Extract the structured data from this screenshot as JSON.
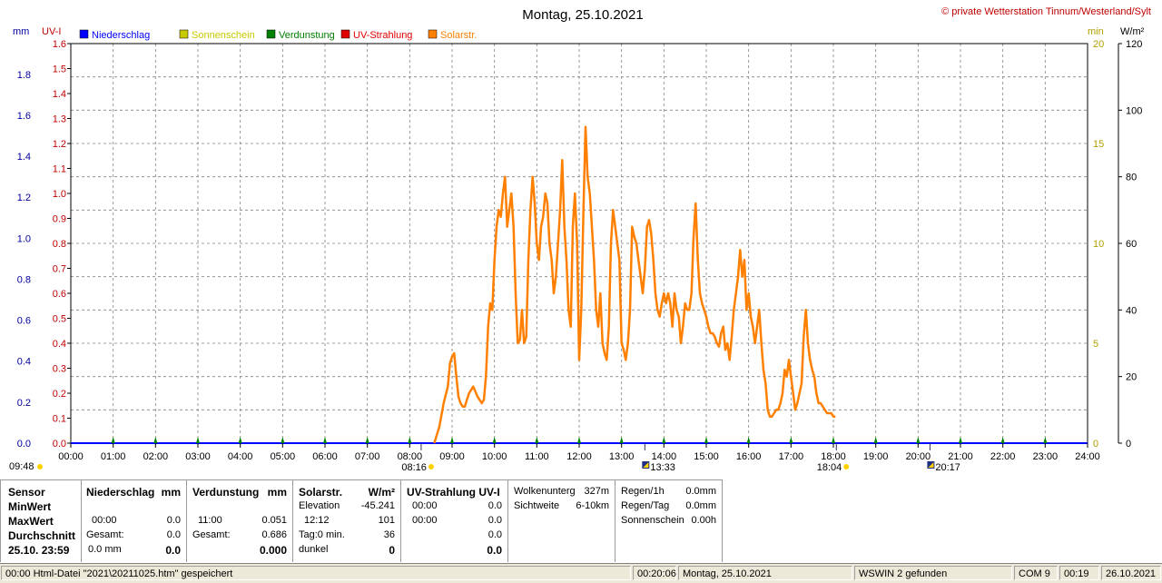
{
  "chart_data": {
    "type": "line",
    "title": "Montag, 25.10.2021",
    "copyright": "© private Wetterstation Tinnum/Westerland/Sylt",
    "legend": [
      {
        "name": "Niederschlag",
        "color": "#0000ff"
      },
      {
        "name": "Sonnenschein",
        "color": "#c8c800"
      },
      {
        "name": "Verdunstung",
        "color": "#008000"
      },
      {
        "name": "UV-Strahlung",
        "color": "#e00000"
      },
      {
        "name": "Solarstr.",
        "color": "#ff8000"
      }
    ],
    "axes": {
      "mm": {
        "label": "mm",
        "color": "#0000a0",
        "ticks": [
          "0.0",
          "0.2",
          "0.4",
          "0.6",
          "0.8",
          "1.0",
          "1.2",
          "1.4",
          "1.6",
          "1.8"
        ],
        "range": [
          0,
          1.95
        ]
      },
      "uv": {
        "label": "UV-I",
        "color": "#c00000",
        "ticks": [
          "0.0",
          "0.1",
          "0.2",
          "0.3",
          "0.4",
          "0.5",
          "0.6",
          "0.7",
          "0.8",
          "0.9",
          "1.0",
          "1.1",
          "1.2",
          "1.3",
          "1.4",
          "1.5",
          "1.6"
        ],
        "range": [
          0,
          1.6
        ]
      },
      "min": {
        "label": "min",
        "color": "#b0a000",
        "ticks": [
          "0",
          "5",
          "10",
          "15",
          "20"
        ],
        "range": [
          0,
          20
        ]
      },
      "wm2": {
        "label": "W/m²",
        "color": "#000000",
        "ticks": [
          "0",
          "20",
          "40",
          "60",
          "80",
          "100",
          "120"
        ],
        "range": [
          0,
          120
        ]
      },
      "x": {
        "ticks": [
          "00:00",
          "01:00",
          "02:00",
          "03:00",
          "04:00",
          "05:00",
          "06:00",
          "07:00",
          "08:00",
          "09:00",
          "10:00",
          "11:00",
          "12:00",
          "13:00",
          "14:00",
          "15:00",
          "16:00",
          "17:00",
          "18:00",
          "19:00",
          "20:00",
          "21:00",
          "22:00",
          "23:00",
          "24:00"
        ],
        "range": [
          0,
          24
        ]
      }
    },
    "grid": true,
    "solar": {
      "name": "Solarstr.",
      "color": "#ff8000",
      "axis": "wm2",
      "x": [
        8.58,
        8.7,
        8.8,
        8.9,
        8.95,
        9.0,
        9.05,
        9.1,
        9.15,
        9.2,
        9.25,
        9.3,
        9.35,
        9.4,
        9.5,
        9.6,
        9.7,
        9.75,
        9.8,
        9.85,
        9.9,
        9.95,
        10.0,
        10.05,
        10.1,
        10.15,
        10.2,
        10.25,
        10.3,
        10.35,
        10.4,
        10.45,
        10.5,
        10.55,
        10.6,
        10.65,
        10.7,
        10.75,
        10.8,
        10.85,
        10.9,
        10.95,
        11.0,
        11.05,
        11.1,
        11.15,
        11.2,
        11.25,
        11.3,
        11.35,
        11.4,
        11.45,
        11.5,
        11.55,
        11.6,
        11.65,
        11.7,
        11.75,
        11.8,
        11.85,
        11.9,
        11.95,
        12.0,
        12.05,
        12.1,
        12.15,
        12.2,
        12.25,
        12.3,
        12.35,
        12.4,
        12.45,
        12.5,
        12.55,
        12.6,
        12.65,
        12.7,
        12.75,
        12.8,
        12.85,
        12.9,
        12.95,
        13.0,
        13.05,
        13.1,
        13.15,
        13.2,
        13.25,
        13.3,
        13.35,
        13.4,
        13.45,
        13.5,
        13.55,
        13.6,
        13.65,
        13.7,
        13.75,
        13.8,
        13.85,
        13.9,
        13.95,
        14.0,
        14.05,
        14.1,
        14.15,
        14.2,
        14.25,
        14.3,
        14.35,
        14.4,
        14.45,
        14.5,
        14.55,
        14.6,
        14.65,
        14.7,
        14.75,
        14.8,
        14.85,
        14.9,
        14.95,
        15.0,
        15.05,
        15.1,
        15.15,
        15.2,
        15.25,
        15.3,
        15.35,
        15.4,
        15.45,
        15.5,
        15.55,
        15.6,
        15.65,
        15.7,
        15.75,
        15.8,
        15.85,
        15.9,
        15.95,
        16.0,
        16.05,
        16.1,
        16.15,
        16.2,
        16.25,
        16.3,
        16.35,
        16.4,
        16.45,
        16.5,
        16.55,
        16.6,
        16.65,
        16.7,
        16.75,
        16.8,
        16.85,
        16.9,
        16.95,
        17.0,
        17.05,
        17.1,
        17.15,
        17.2,
        17.25,
        17.3,
        17.35,
        17.4,
        17.45,
        17.5,
        17.55,
        17.6,
        17.65,
        17.7,
        17.75,
        17.8,
        17.85,
        17.9,
        17.95,
        18.0,
        18.05
      ],
      "values": [
        0,
        5,
        12,
        17,
        24,
        26,
        27,
        20,
        14,
        12,
        11,
        11,
        13,
        15,
        17,
        14,
        12,
        13,
        20,
        35,
        42,
        40,
        55,
        65,
        70,
        68,
        75,
        80,
        65,
        70,
        75,
        65,
        45,
        30,
        31,
        40,
        30,
        32,
        55,
        70,
        80,
        72,
        60,
        55,
        65,
        68,
        75,
        72,
        60,
        55,
        45,
        50,
        60,
        70,
        85,
        65,
        55,
        40,
        35,
        65,
        75,
        60,
        25,
        40,
        70,
        95,
        80,
        75,
        65,
        55,
        40,
        35,
        45,
        30,
        27,
        25,
        35,
        60,
        70,
        65,
        60,
        55,
        30,
        28,
        25,
        30,
        40,
        65,
        62,
        60,
        55,
        50,
        45,
        52,
        65,
        67,
        63,
        55,
        45,
        40,
        38,
        42,
        45,
        42,
        45,
        42,
        35,
        45,
        40,
        38,
        30,
        35,
        42,
        40,
        40,
        45,
        62,
        72,
        55,
        45,
        42,
        40,
        38,
        35,
        33,
        33,
        32,
        30,
        29,
        33,
        35,
        28,
        30,
        25,
        32,
        40,
        45,
        50,
        58,
        50,
        55,
        40,
        45,
        38,
        35,
        30,
        35,
        40,
        30,
        22,
        18,
        10,
        8,
        8,
        9,
        10,
        10,
        12,
        15,
        22,
        20,
        25,
        20,
        15,
        10,
        12,
        15,
        18,
        32,
        40,
        30,
        25,
        22,
        20,
        15,
        12,
        12,
        11,
        10,
        9,
        9,
        9,
        8,
        8,
        5,
        0
      ]
    },
    "markers": [
      {
        "label": "08:16",
        "hour": 8.27
      },
      {
        "label": "13:33",
        "hour": 13.55
      },
      {
        "label": "18:04",
        "hour": 18.07
      },
      {
        "label": "20:17",
        "hour": 20.28
      }
    ],
    "left_marker": "09:48"
  },
  "table": {
    "sensor": {
      "header": "Sensor",
      "rows": [
        "MinWert",
        "MaxWert",
        "Durchschnitt",
        "25.10.  23:59"
      ]
    },
    "niederschlag": {
      "title": "Niederschlag",
      "unit": "mm",
      "max_time": "00:00",
      "max_val": "0.0",
      "total_label": "Gesamt:",
      "total_val": "0.0",
      "avg_left": "0.0 mm",
      "avg_right": "0.0"
    },
    "verdunstung": {
      "title": "Verdunstung",
      "unit": "mm",
      "max_time": "11:00",
      "max_val": "0.051",
      "total_label": "Gesamt:",
      "total_val": "0.686",
      "avg_right": "0.000"
    },
    "solar": {
      "title": "Solarstr.",
      "unit": "W/m²",
      "elev_label": "Elevation",
      "elev_val": "-45.241",
      "max_time": "12:12",
      "max_val": "101",
      "tag_label": "Tag:0 min.",
      "tag_val": "36",
      "dunkel_label": "dunkel",
      "dunkel_val": "0"
    },
    "uv": {
      "title": "UV-Strahlung UV-I",
      "min_time": "00:00",
      "min_val": "0.0",
      "max_time": "00:00",
      "max_val": "0.0",
      "avg_val": "0.0",
      "cur_val": "0.0"
    },
    "cloud": {
      "label1": "Wolkenunterg",
      "val1": "327m",
      "label2": "Sichtweite",
      "val2": "6-10km"
    },
    "rain": {
      "label1": "Regen/1h",
      "val1": "0.0mm",
      "label2": "Regen/Tag",
      "val2": "0.0mm",
      "label3": "Sonnenschein",
      "val3": "0.00h"
    }
  },
  "status": {
    "cell1": "00:00  Html-Datei  \"2021\\20211025.htm\"  gespeichert",
    "cell2": "00:20:06",
    "cell3": "Montag, 25.10.2021",
    "cell4": "WSWIN 2 gefunden",
    "cell5": "COM 9",
    "cell6": "00:19",
    "cell7": "26.10.2021"
  }
}
